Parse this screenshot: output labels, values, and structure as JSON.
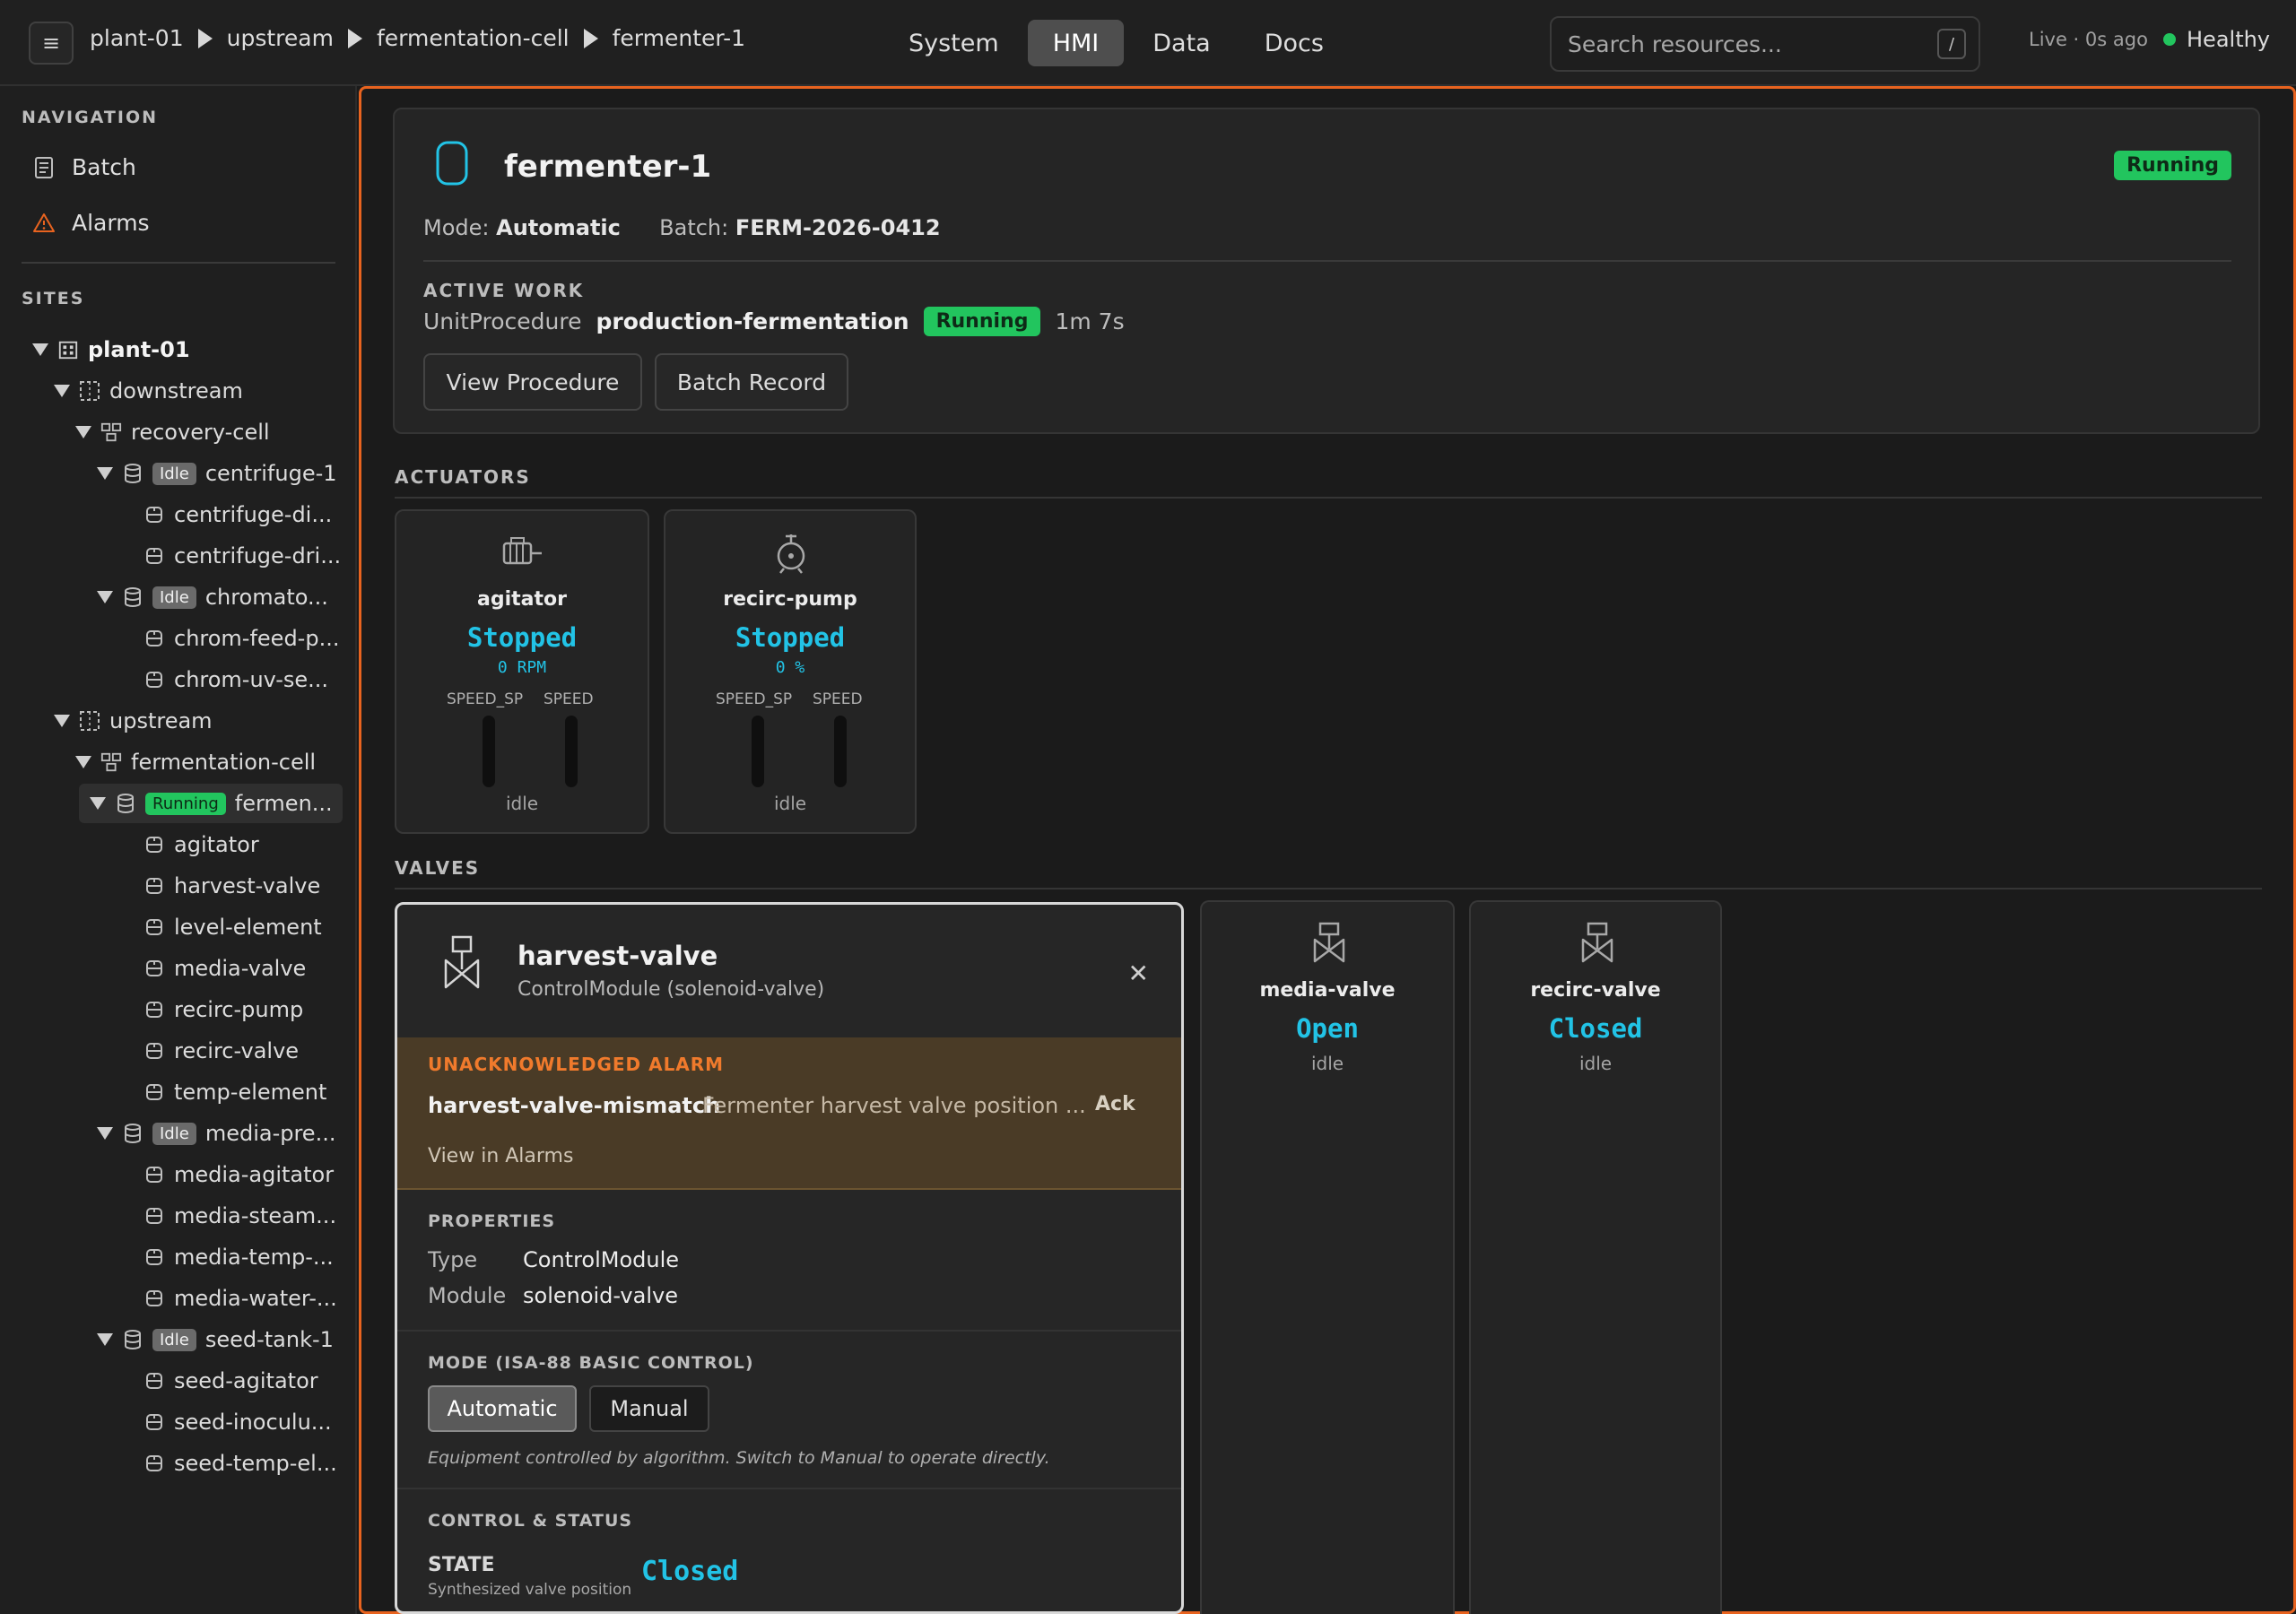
{
  "breadcrumb": [
    "plant-01",
    "upstream",
    "fermentation-cell",
    "fermenter-1"
  ],
  "main_tabs": [
    {
      "label": "System",
      "active": false
    },
    {
      "label": "HMI",
      "active": true
    },
    {
      "label": "Data",
      "active": false
    },
    {
      "label": "Docs",
      "active": false
    }
  ],
  "search": {
    "placeholder": "Search resources...",
    "shortcut": "/"
  },
  "status": {
    "live": "Live · 0s ago",
    "health": "Healthy",
    "health_color": "#22c55e"
  },
  "sidebar": {
    "nav_title": "NAVIGATION",
    "nav_items": [
      {
        "label": "Batch",
        "icon": "document-icon"
      },
      {
        "label": "Alarms",
        "icon": "warning-icon"
      }
    ],
    "sites_title": "SITES",
    "tree": [
      {
        "label": "plant-01",
        "bold": true
      },
      {
        "label": "downstream"
      },
      {
        "label": "recovery-cell"
      },
      {
        "label": "centrifuge-1",
        "badge": "Idle"
      },
      {
        "label": "centrifuge-di..."
      },
      {
        "label": "centrifuge-dri..."
      },
      {
        "label": "chromato...",
        "badge": "Idle"
      },
      {
        "label": "chrom-feed-p..."
      },
      {
        "label": "chrom-uv-se..."
      },
      {
        "label": "upstream"
      },
      {
        "label": "fermentation-cell"
      },
      {
        "label": "fermen...",
        "badge": "Running"
      },
      {
        "label": "agitator"
      },
      {
        "label": "harvest-valve"
      },
      {
        "label": "level-element"
      },
      {
        "label": "media-valve"
      },
      {
        "label": "recirc-pump"
      },
      {
        "label": "recirc-valve"
      },
      {
        "label": "temp-element"
      },
      {
        "label": "media-pre...",
        "badge": "Idle"
      },
      {
        "label": "media-agitator"
      },
      {
        "label": "media-steam..."
      },
      {
        "label": "media-temp-..."
      },
      {
        "label": "media-water-..."
      },
      {
        "label": "seed-tank-1",
        "badge": "Idle"
      },
      {
        "label": "seed-agitator"
      },
      {
        "label": "seed-inoculu..."
      },
      {
        "label": "seed-temp-el..."
      }
    ]
  },
  "unit": {
    "name": "fermenter-1",
    "status": "Running",
    "mode_label": "Mode:",
    "mode_value": "Automatic",
    "batch_label": "Batch:",
    "batch_value": "FERM-2026-0412",
    "active_work_title": "ACTIVE WORK",
    "procedure_type": "UnitProcedure",
    "procedure_name": "production-fermentation",
    "procedure_status": "Running",
    "elapsed": "1m 7s",
    "view_procedure_label": "View Procedure",
    "batch_record_label": "Batch Record"
  },
  "actuators": {
    "title": "ACTUATORS",
    "items": [
      {
        "name": "agitator",
        "state": "Stopped",
        "reading": "0 RPM",
        "bar1": "SPEED_SP",
        "bar2": "SPEED",
        "mode": "idle",
        "icon": "motor-icon"
      },
      {
        "name": "recirc-pump",
        "state": "Stopped",
        "reading": "0 %",
        "bar1": "SPEED_SP",
        "bar2": "SPEED",
        "mode": "idle",
        "icon": "pump-icon"
      }
    ]
  },
  "valves": {
    "title": "VALVES",
    "items": [
      {
        "name": "media-valve",
        "state": "Open",
        "mode": "idle",
        "icon": "valve-icon"
      },
      {
        "name": "recirc-valve",
        "state": "Closed",
        "mode": "idle",
        "icon": "valve-icon"
      }
    ]
  },
  "detail": {
    "name": "harvest-valve",
    "subtitle": "ControlModule (solenoid-valve)",
    "alarm_title": "UNACKNOWLEDGED ALARM",
    "alarm_name": "harvest-valve-mismatch",
    "alarm_message": "Fermenter harvest valve position ...",
    "ack_label": "Ack",
    "view_alarms_label": "View in Alarms",
    "properties_title": "PROPERTIES",
    "props": [
      {
        "key": "Type",
        "value": "ControlModule"
      },
      {
        "key": "Module",
        "value": "solenoid-valve"
      }
    ],
    "mode_title": "MODE (ISA-88 BASIC CONTROL)",
    "mode_auto": "Automatic",
    "mode_manual": "Manual",
    "mode_note": "Equipment controlled by algorithm. Switch to Manual to operate directly.",
    "control_title": "CONTROL & STATUS",
    "state_label": "STATE",
    "state_sub": "Synthesized valve position",
    "state_value": "Closed"
  },
  "colors": {
    "accent": "#e8631f",
    "running": "#22c55e",
    "value": "#22c3e6",
    "alarm_bg": "#4a3b26",
    "alarm_text": "#f07a2c"
  }
}
